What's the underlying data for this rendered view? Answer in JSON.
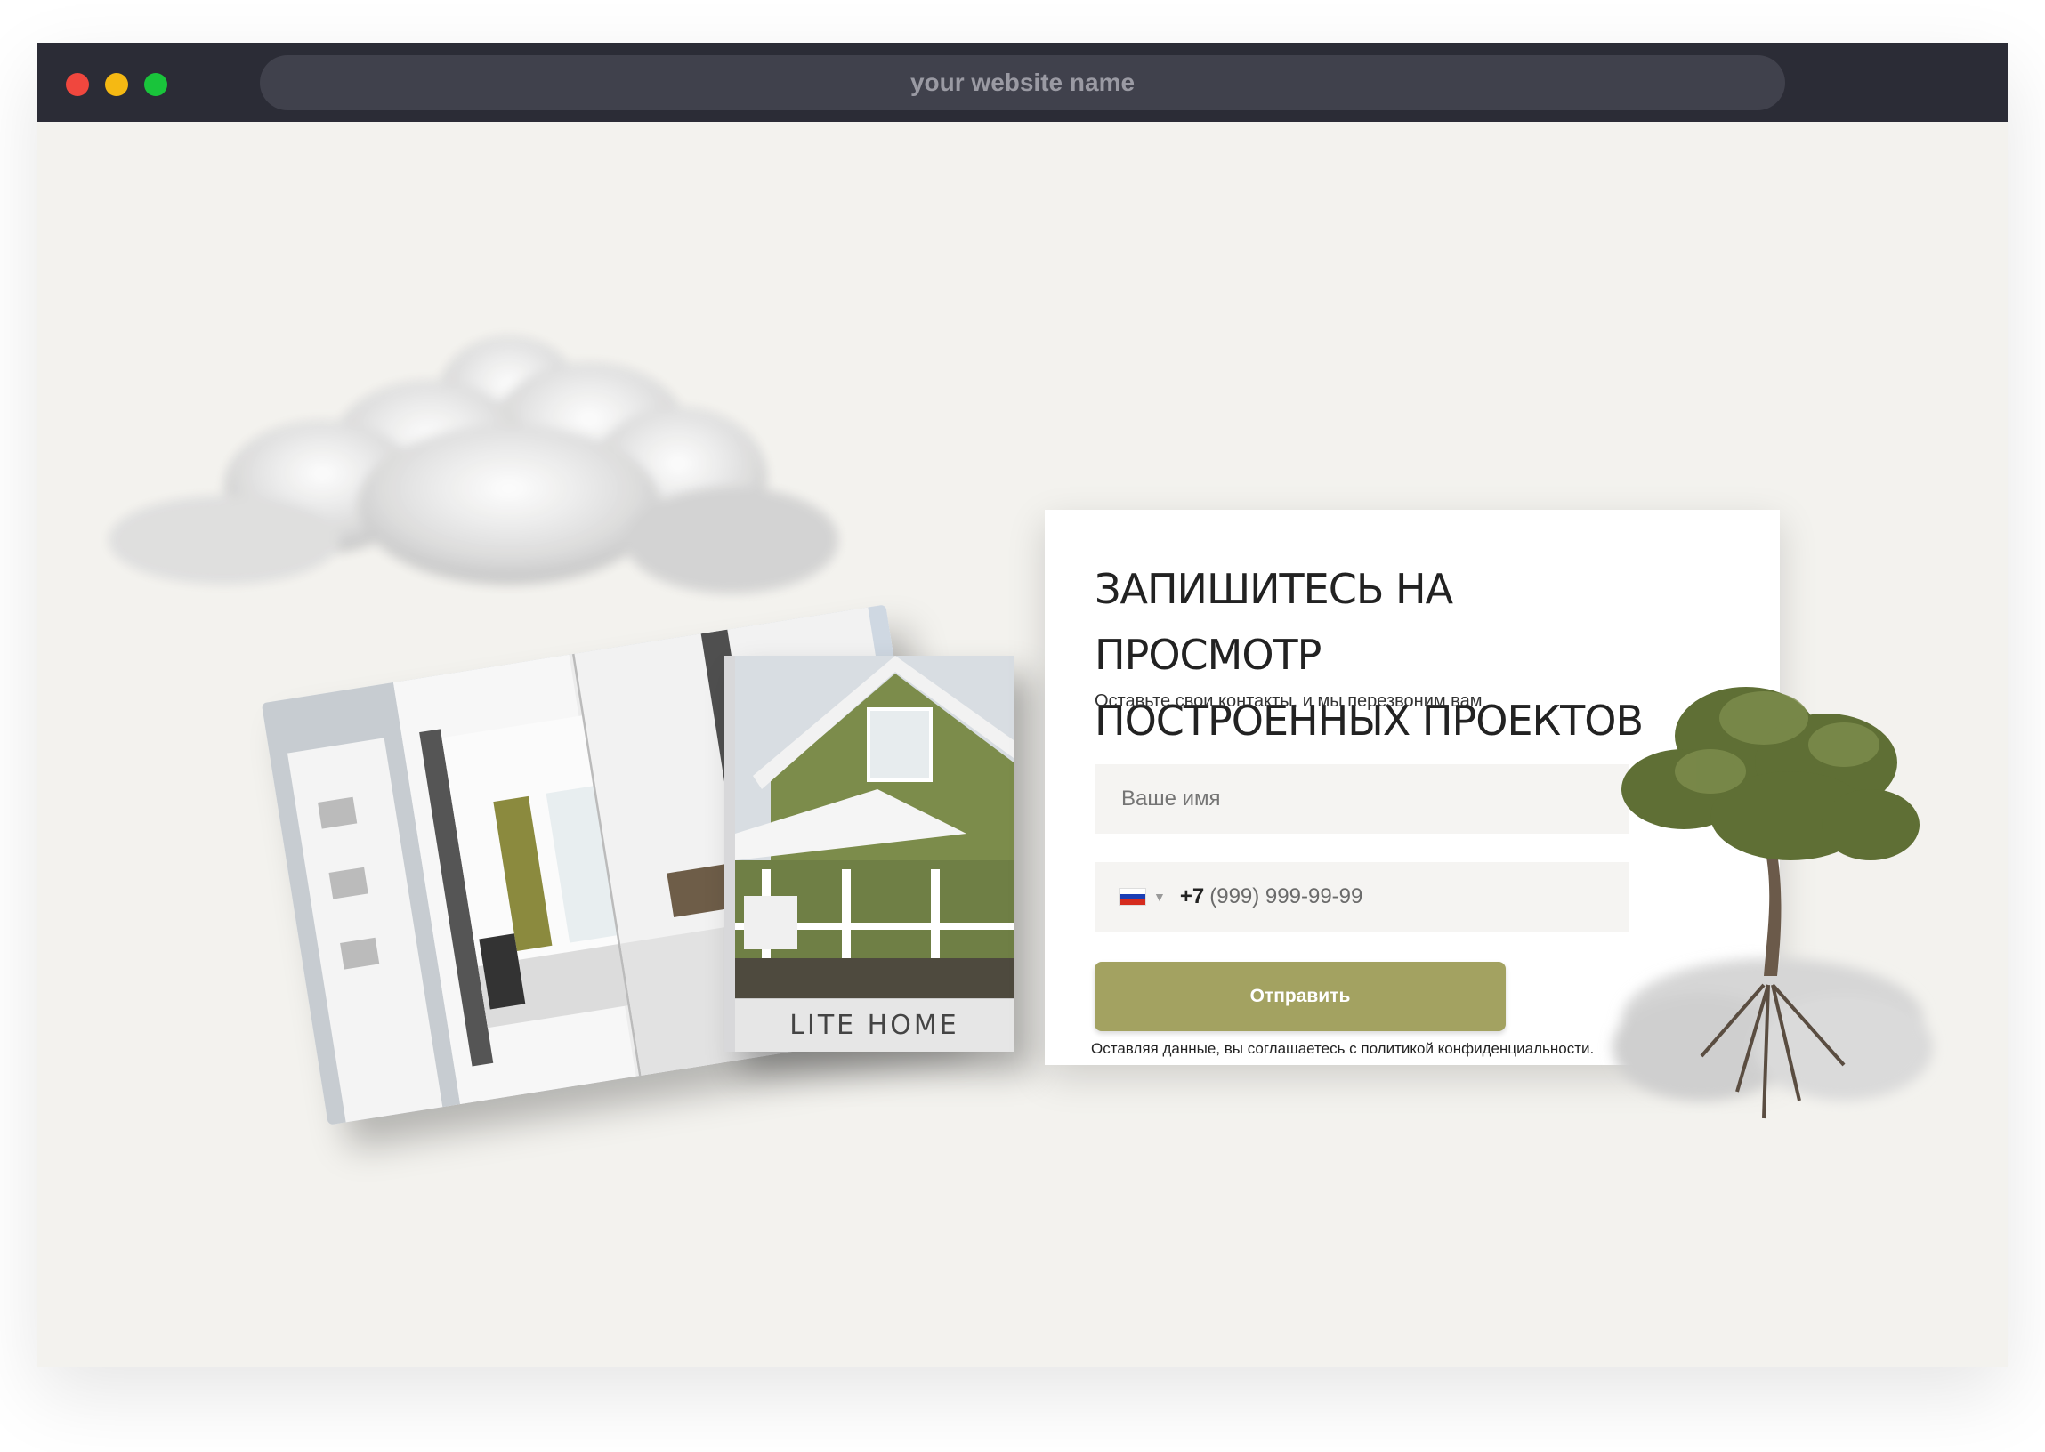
{
  "browser": {
    "url_text": "your website name",
    "window_controls": [
      "close-dot",
      "minimize-dot",
      "maximize-dot"
    ]
  },
  "colors": {
    "accent": "#a3a261",
    "page_background": "#f3f2ee",
    "titlebar": "#2b2c36"
  },
  "book": {
    "caption": "LITE HOME"
  },
  "form": {
    "title_line1": "Запишитесь на просмотр",
    "title_line2": "построенных проектов",
    "subtitle": "Оставьте свои контакты, и мы перезвоним вам",
    "name_placeholder": "Ваше имя",
    "phone_country": "ru-flag-icon",
    "phone_code": "+7",
    "phone_mask": "(999) 999-99-99",
    "submit_label": "Отправить",
    "consent": "Оставляя данные, вы соглашаетесь с политикой конфиденциальности."
  }
}
